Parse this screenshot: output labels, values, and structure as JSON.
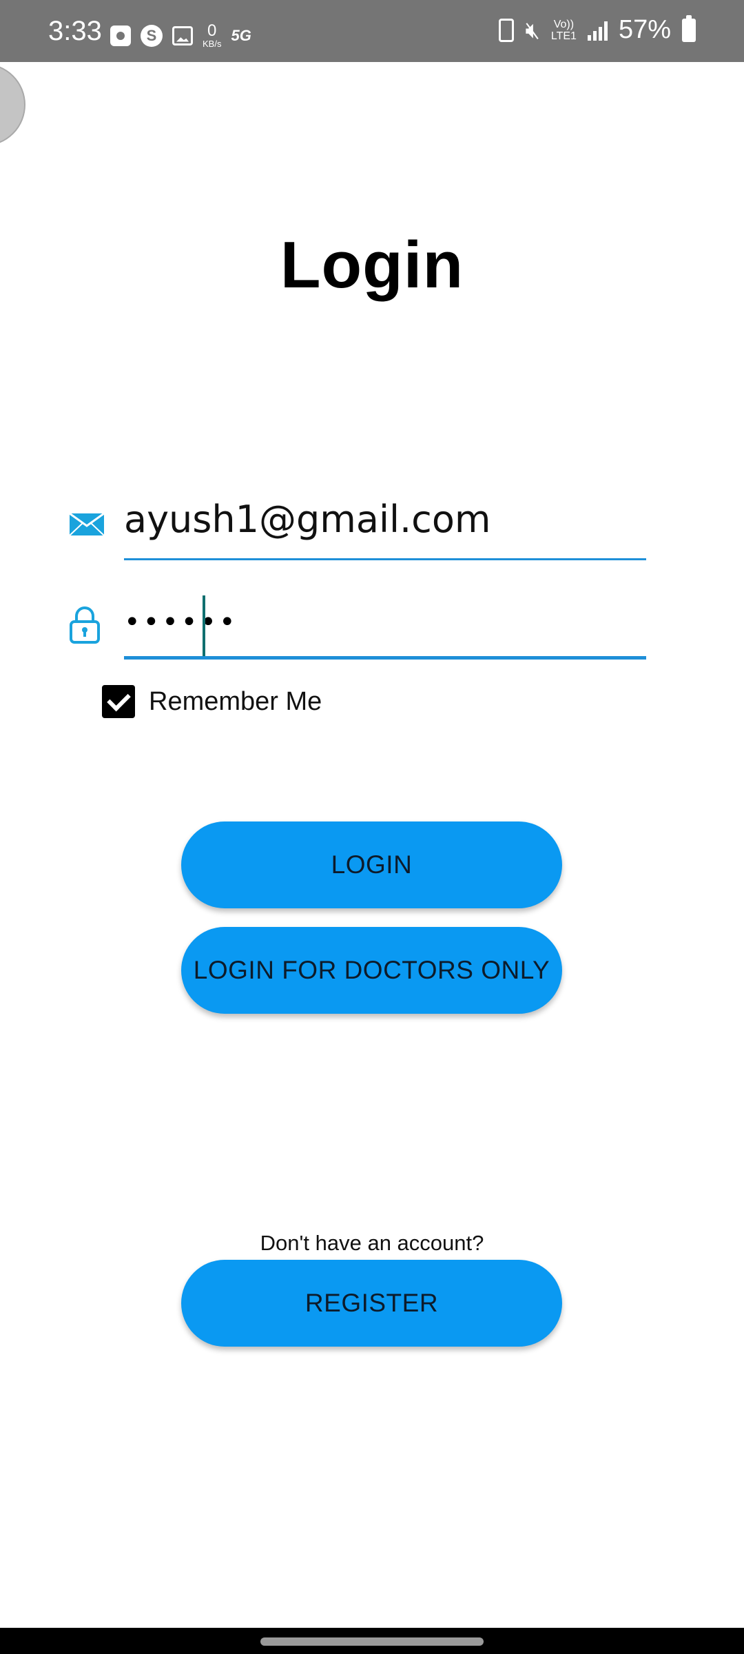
{
  "status_bar": {
    "time": "3:33",
    "data_speed_value": "0",
    "data_speed_unit": "KB/s",
    "network_badge": "5G",
    "volte_top": "Vo))",
    "volte_bottom": "LTE1",
    "battery_percent": "57%",
    "left_icons": [
      "alarm-icon",
      "s-app-icon",
      "gallery-icon"
    ],
    "right_icons": [
      "battery-saver-icon",
      "mute-icon",
      "volte-icon",
      "signal-icon",
      "battery-icon"
    ]
  },
  "login": {
    "title": "Login",
    "email": {
      "value": "ayush1@gmail.com",
      "icon": "email-icon"
    },
    "password": {
      "masked_value": "••••••",
      "icon": "lock-icon"
    },
    "remember_me": {
      "label": "Remember Me",
      "checked": true
    },
    "login_button": "LOGIN",
    "doctors_button": "LOGIN FOR DOCTORS ONLY",
    "no_account_text": "Don't have an account?",
    "register_button": "REGISTER"
  },
  "colors": {
    "accent": "#0a99f2",
    "field_underline": "#1e8fd8",
    "status_bar": "#757575",
    "icon_blue": "#1aa3dd"
  }
}
